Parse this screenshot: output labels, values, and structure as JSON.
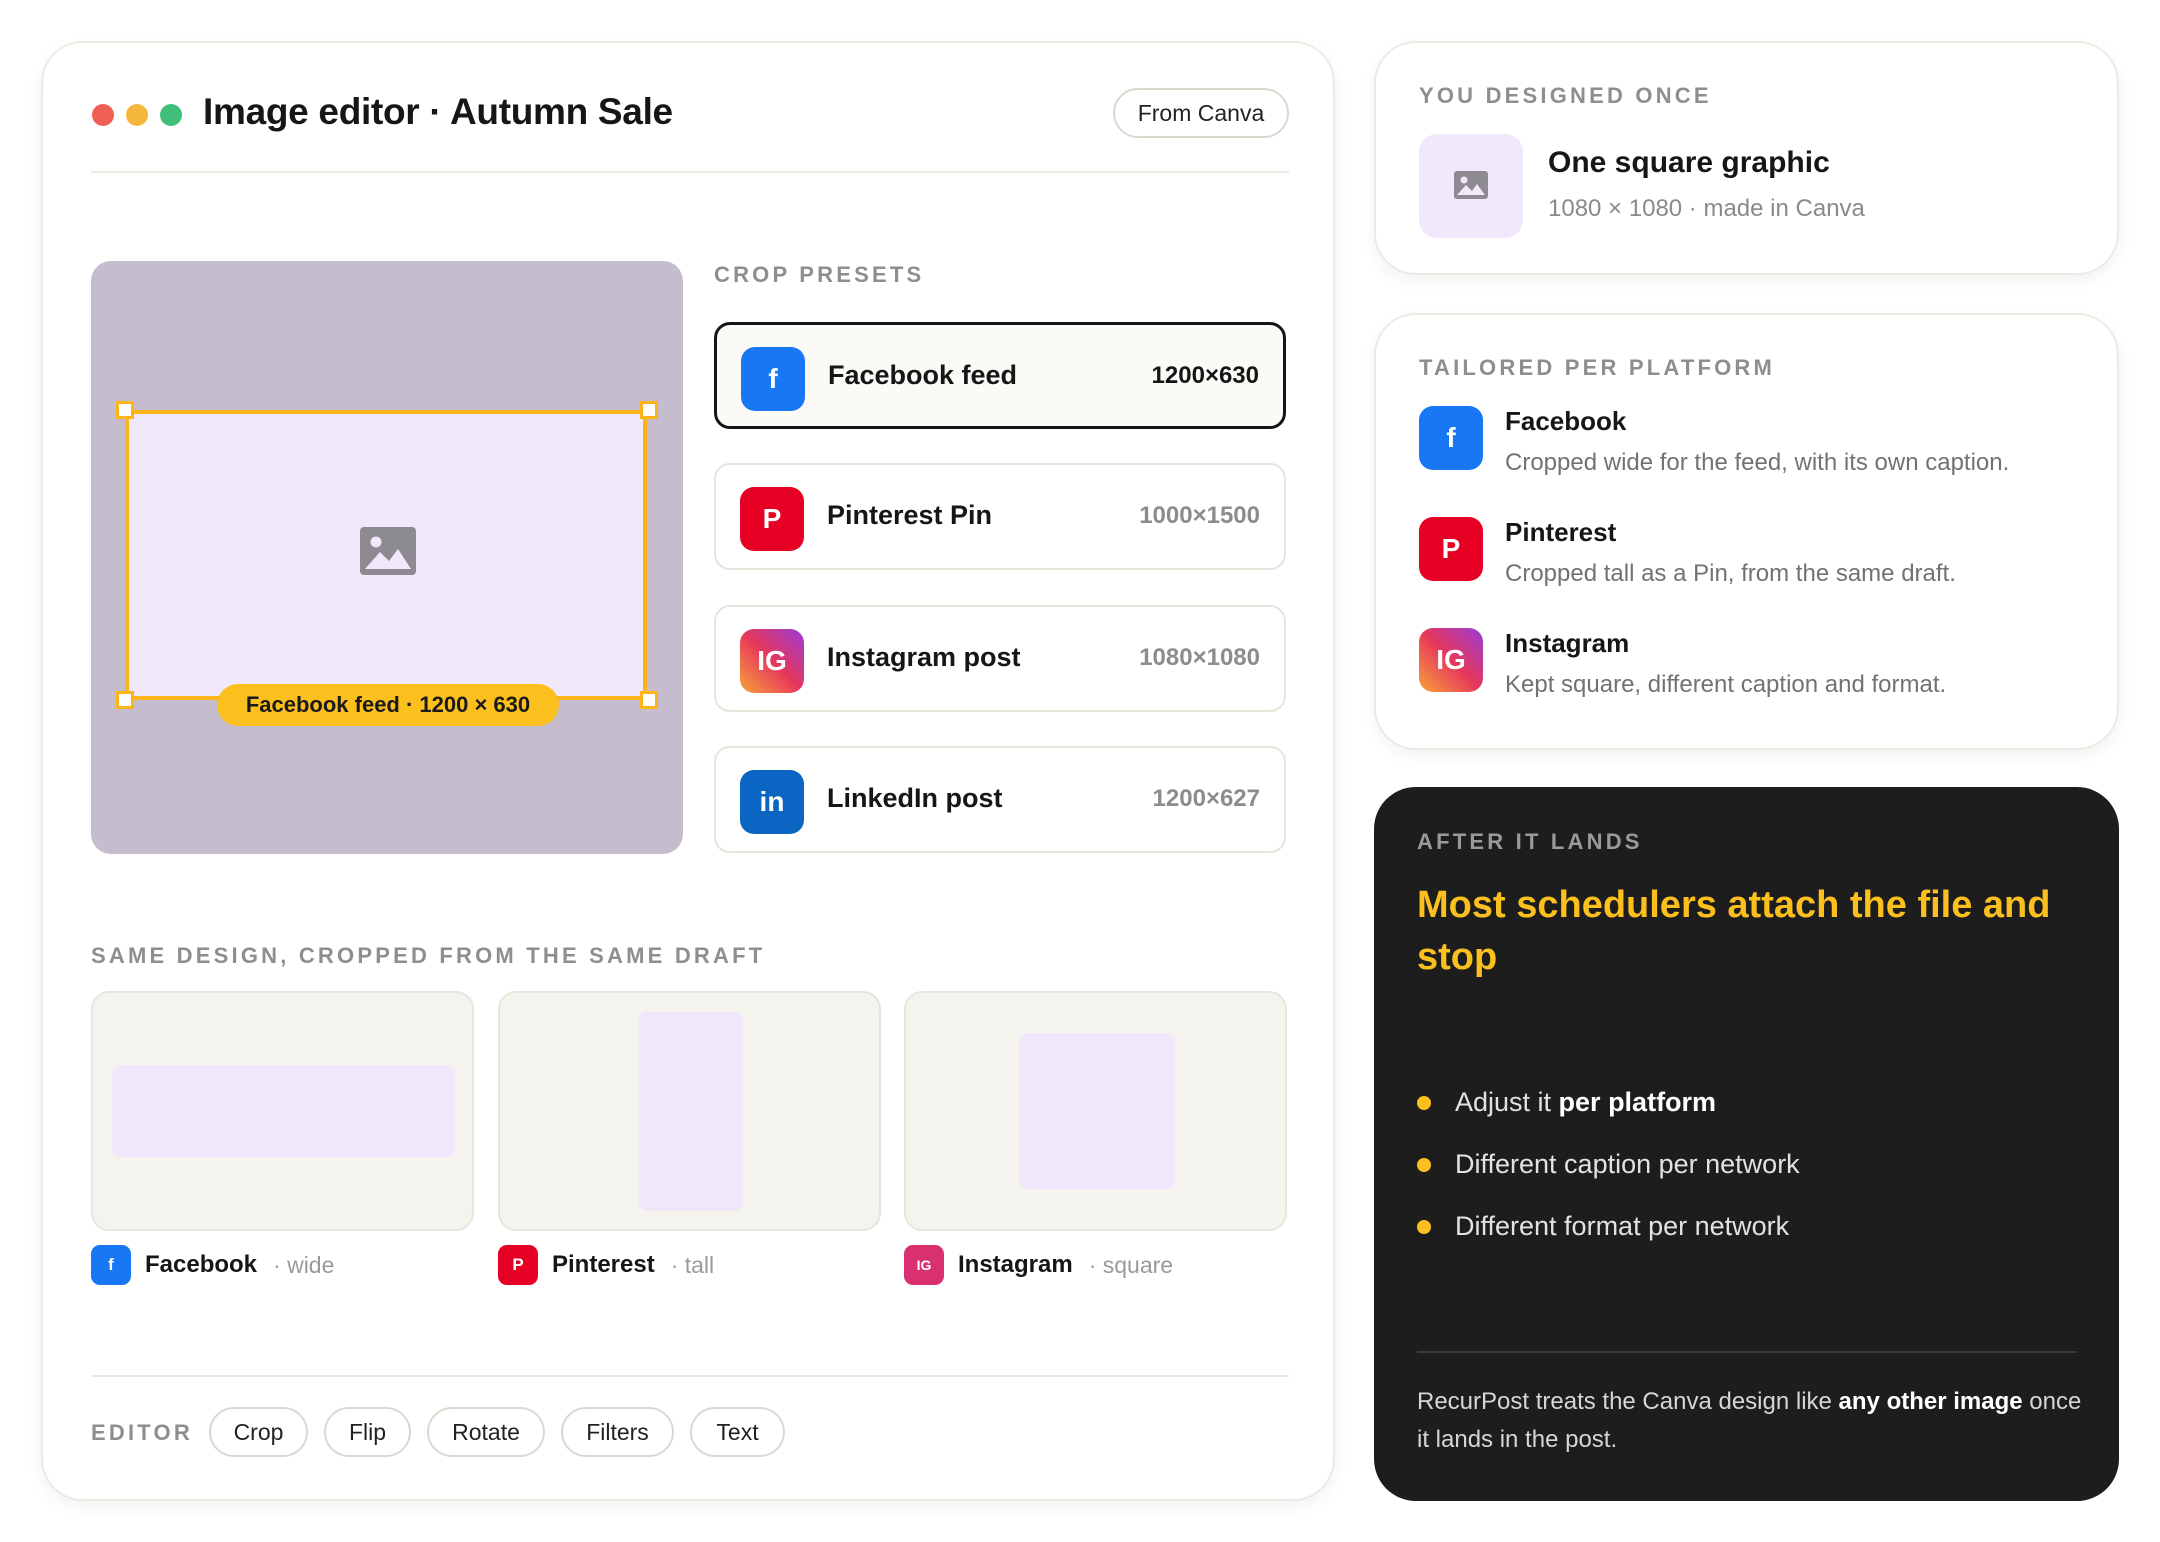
{
  "editor": {
    "title": "Image editor · Autumn Sale",
    "source_badge": "From Canva",
    "window_dots": [
      "#ee5f54",
      "#f5b73b",
      "#3fbf79"
    ],
    "crop_label": "Facebook feed · 1200 × 630",
    "presets_label": "CROP PRESETS",
    "presets": [
      {
        "icon": "f",
        "name": "Facebook feed",
        "size": "1200×630",
        "active": true
      },
      {
        "icon": "P",
        "name": "Pinterest Pin",
        "size": "1000×1500",
        "active": false
      },
      {
        "icon": "IG",
        "name": "Instagram post",
        "size": "1080×1080",
        "active": false
      },
      {
        "icon": "in",
        "name": "LinkedIn post",
        "size": "1200×627",
        "active": false
      }
    ],
    "same_design_label": "SAME DESIGN, CROPPED FROM THE SAME DRAFT",
    "thumbs": [
      {
        "icon": "f",
        "name": "Facebook",
        "desc": "· wide"
      },
      {
        "icon": "P",
        "name": "Pinterest",
        "desc": "· tall"
      },
      {
        "icon": "IG",
        "name": "Instagram",
        "desc": "· square"
      }
    ],
    "tools_label": "EDITOR",
    "tools": [
      "Crop",
      "Flip",
      "Rotate",
      "Filters",
      "Text"
    ]
  },
  "designed": {
    "label": "YOU DESIGNED ONCE",
    "title": "One square graphic",
    "subtitle": "1080 × 1080 · made in Canva"
  },
  "tailored": {
    "label": "TAILORED PER PLATFORM",
    "items": [
      {
        "icon": "f",
        "name": "Facebook",
        "desc": "Cropped wide for the feed, with its own caption."
      },
      {
        "icon": "P",
        "name": "Pinterest",
        "desc": "Cropped tall as a Pin, from the same draft."
      },
      {
        "icon": "IG",
        "name": "Instagram",
        "desc": "Kept square, different caption and format."
      }
    ]
  },
  "after": {
    "label": "AFTER IT LANDS",
    "title": "Most schedulers attach the file and stop",
    "bullets": [
      {
        "text": "Adjust it ",
        "bold": "per platform"
      },
      {
        "text": "Different caption per network",
        "bold": ""
      },
      {
        "text": "Different format per network",
        "bold": ""
      }
    ],
    "note_pre": "RecurPost treats the Canva design like ",
    "note_bold": "any other image",
    "note_post": " once it lands in the post."
  },
  "colors": {
    "accent": "#fbbf1e",
    "facebook": "#1877f2",
    "pinterest": "#e60023",
    "linkedin": "#0a66c2"
  }
}
